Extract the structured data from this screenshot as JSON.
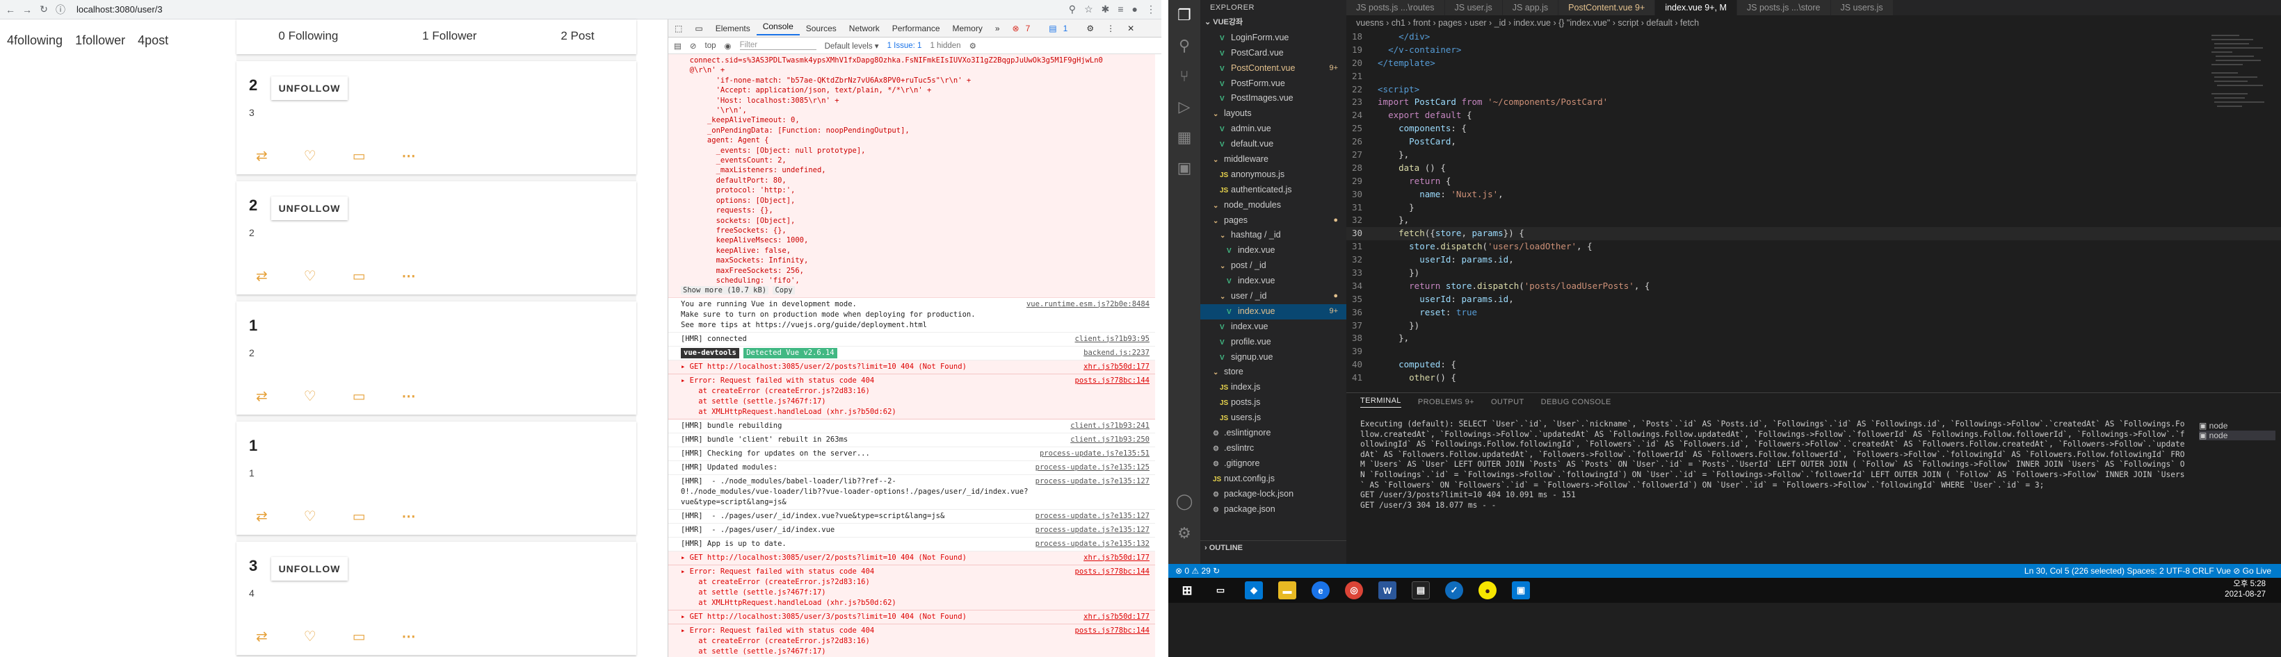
{
  "browser": {
    "url": "localhost:3080/user/3",
    "stats": [
      "4following",
      "1follower",
      "4post"
    ],
    "profile_counts": [
      "0 Following",
      "1 Follower",
      "2 Post"
    ],
    "posts": [
      {
        "num": "2",
        "button": "UNFOLLOW",
        "text": "3"
      },
      {
        "num": "2",
        "button": "UNFOLLOW",
        "text": "2"
      },
      {
        "num": "1",
        "button": "",
        "text": "2"
      },
      {
        "num": "1",
        "button": "",
        "text": "1"
      },
      {
        "num": "3",
        "button": "UNFOLLOW",
        "text": "4"
      }
    ]
  },
  "devtools": {
    "tabs": [
      "Elements",
      "Console",
      "Sources",
      "Network",
      "Performance",
      "Memory",
      "»"
    ],
    "issues_count": "7",
    "msg_count": "1",
    "filter_context": "top",
    "filter_placeholder": "Filter",
    "levels": "Default levels ▾",
    "issue_badge": "1 Issue: 1",
    "hidden": "1 hidden",
    "error_box": "  connect.sid=s%3AS3PDLTwasmk4ypsXMhV1fxDapg8Ozhka.FsNIFmkEIsIUVXo3I1gZ2BqgpJuUwOk3g5M1F9gHjwLn0\n  @\\r\\n' +\n        'if-none-match: \"b57ae-QKtdZbrNz7vU6Ax8PV0+ruTuc5s\"\\r\\n' +\n        'Accept: application/json, text/plain, */*\\r\\n' +\n        'Host: localhost:3085\\r\\n' +\n        '\\r\\n',\n      _keepAliveTimeout: 0,\n      _onPendingData: [Function: noopPendingOutput],\n      agent: Agent {\n        _events: [Object: null prototype],\n        _eventsCount: 2,\n        _maxListeners: undefined,\n        defaultPort: 80,\n        protocol: 'http:',\n        options: [Object],\n        requests: {},\n        sockets: [Object],\n        freeSockets: {},\n        keepAliveMsecs: 1000,\n        keepAlive: false,\n        maxSockets: Infinity,\n        maxFreeSockets: 256,\n        scheduling: 'fifo',",
    "show_more": "Show more (10.7 kB)",
    "copy": "Copy",
    "lines": [
      {
        "text": "You are running Vue in development mode.\nMake sure to turn on production mode when deploying for production.\nSee more tips at https://vuejs.org/guide/deployment.html",
        "src": "vue.runtime.esm.js?2b0e:8484",
        "err": false
      },
      {
        "text": "[HMR] connected",
        "src": "client.js?1b93:95",
        "err": false
      },
      {
        "text": "vue-devtools  Detected Vue v2.6.14",
        "src": "backend.js:2237",
        "err": false,
        "badge": true
      },
      {
        "text": "▸ GET http://localhost:3085/user/2/posts?limit=10 404 (Not Found)",
        "src": "xhr.js?b50d:177",
        "err": true
      },
      {
        "text": "▸ Error: Request failed with status code 404\n    at createError (createError.js?2d83:16)\n    at settle (settle.js?467f:17)\n    at XMLHttpRequest.handleLoad (xhr.js?b50d:62)",
        "src": "posts.js?78bc:144",
        "err": true
      },
      {
        "text": "[HMR] bundle rebuilding",
        "src": "client.js?1b93:241",
        "err": false
      },
      {
        "text": "[HMR] bundle 'client' rebuilt in 263ms",
        "src": "client.js?1b93:250",
        "err": false
      },
      {
        "text": "[HMR] Checking for updates on the server...",
        "src": "process-update.js?e135:51",
        "err": false
      },
      {
        "text": "[HMR] Updated modules:",
        "src": "process-update.js?e135:125",
        "err": false
      },
      {
        "text": "[HMR]  - ./node_modules/babel-loader/lib??ref--2-\n0!./node_modules/vue-loader/lib??vue-loader-options!./pages/user/_id/index.vue?\nvue&type=script&lang=js&",
        "src": "process-update.js?e135:127",
        "err": false
      },
      {
        "text": "[HMR]  - ./pages/user/_id/index.vue?vue&type=script&lang=js&",
        "src": "process-update.js?e135:127",
        "err": false
      },
      {
        "text": "[HMR]  - ./pages/user/_id/index.vue",
        "src": "process-update.js?e135:127",
        "err": false
      },
      {
        "text": "[HMR] App is up to date.",
        "src": "process-update.js?e135:132",
        "err": false
      },
      {
        "text": "▸ GET http://localhost:3085/user/2/posts?limit=10 404 (Not Found)",
        "src": "xhr.js?b50d:177",
        "err": true
      },
      {
        "text": "▸ Error: Request failed with status code 404\n    at createError (createError.js?2d83:16)\n    at settle (settle.js?467f:17)\n    at XMLHttpRequest.handleLoad (xhr.js?b50d:62)",
        "src": "posts.js?78bc:144",
        "err": true
      },
      {
        "text": "▸ GET http://localhost:3085/user/3/posts?limit=10 404 (Not Found)",
        "src": "xhr.js?b50d:177",
        "err": true
      },
      {
        "text": "▸ Error: Request failed with status code 404\n    at createError (createError.js?2d83:16)\n    at settle (settle.js?467f:17)\n    at XMLHttpRequest.handleLoad (xhr.js?b50d:62)",
        "src": "posts.js?78bc:144",
        "err": true
      }
    ]
  },
  "vscode": {
    "explorer_title": "EXPLORER",
    "workspace": "VUE강좌",
    "outline": "OUTLINE",
    "tree": [
      {
        "n": "LoginForm.vue",
        "t": "vue",
        "d": 2
      },
      {
        "n": "PostCard.vue",
        "t": "vue",
        "d": 2
      },
      {
        "n": "PostContent.vue",
        "t": "vue",
        "d": 2,
        "m": "9+"
      },
      {
        "n": "PostForm.vue",
        "t": "vue",
        "d": 2
      },
      {
        "n": "PostImages.vue",
        "t": "vue",
        "d": 2
      },
      {
        "n": "layouts",
        "t": "fold",
        "d": 1
      },
      {
        "n": "admin.vue",
        "t": "vue",
        "d": 2
      },
      {
        "n": "default.vue",
        "t": "vue",
        "d": 2
      },
      {
        "n": "middleware",
        "t": "fold",
        "d": 1
      },
      {
        "n": "anonymous.js",
        "t": "js",
        "d": 2
      },
      {
        "n": "authenticated.js",
        "t": "js",
        "d": 2
      },
      {
        "n": "node_modules",
        "t": "fold",
        "d": 1
      },
      {
        "n": "pages",
        "t": "fold",
        "d": 1,
        "m": "●"
      },
      {
        "n": "hashtag / _id",
        "t": "fold",
        "d": 2
      },
      {
        "n": "index.vue",
        "t": "vue",
        "d": 3
      },
      {
        "n": "post / _id",
        "t": "fold",
        "d": 2
      },
      {
        "n": "index.vue",
        "t": "vue",
        "d": 3
      },
      {
        "n": "user / _id",
        "t": "fold",
        "d": 2,
        "m": "●"
      },
      {
        "n": "index.vue",
        "t": "vue",
        "d": 3,
        "m": "9+",
        "sel": true
      },
      {
        "n": "index.vue",
        "t": "vue",
        "d": 2
      },
      {
        "n": "profile.vue",
        "t": "vue",
        "d": 2
      },
      {
        "n": "signup.vue",
        "t": "vue",
        "d": 2
      },
      {
        "n": "store",
        "t": "fold",
        "d": 1
      },
      {
        "n": "index.js",
        "t": "js",
        "d": 2
      },
      {
        "n": "posts.js",
        "t": "js",
        "d": 2
      },
      {
        "n": "users.js",
        "t": "js",
        "d": 2
      },
      {
        "n": ".eslintignore",
        "t": "gear",
        "d": 1
      },
      {
        "n": ".eslintrc",
        "t": "gear",
        "d": 1
      },
      {
        "n": ".gitignore",
        "t": "gear",
        "d": 1
      },
      {
        "n": "nuxt.config.js",
        "t": "js",
        "d": 1
      },
      {
        "n": "package-lock.json",
        "t": "gear",
        "d": 1
      },
      {
        "n": "package.json",
        "t": "gear",
        "d": 1
      }
    ],
    "tabs": [
      {
        "label": "JS posts.js ...\\routes",
        "act": false
      },
      {
        "label": "JS user.js",
        "act": false
      },
      {
        "label": "JS app.js",
        "act": false
      },
      {
        "label": "PostContent.vue 9+",
        "act": false,
        "mod": true
      },
      {
        "label": "index.vue 9+, M",
        "act": true
      },
      {
        "label": "JS posts.js ...\\store",
        "act": false
      },
      {
        "label": "JS users.js",
        "act": false
      }
    ],
    "breadcrumb": "vuesns › ch1 › front › pages › user › _id › index.vue › {} \"index.vue\" › script › default › fetch",
    "code": [
      {
        "n": "18",
        "h": "    <span class=\"t\">&lt;/div&gt;</span>"
      },
      {
        "n": "19",
        "h": "  <span class=\"t\">&lt;/v-container&gt;</span>"
      },
      {
        "n": "20",
        "h": "<span class=\"t\">&lt;/template&gt;</span>"
      },
      {
        "n": "21",
        "h": ""
      },
      {
        "n": "22",
        "h": "<span class=\"t\">&lt;script&gt;</span>"
      },
      {
        "n": "23",
        "h": "<span class=\"k\">import</span> <span class=\"p\">PostCard</span> <span class=\"k\">from</span> <span class=\"s\">'~/components/PostCard'</span>"
      },
      {
        "n": "24",
        "h": "  <span class=\"k\">export default</span> {"
      },
      {
        "n": "25",
        "h": "    <span class=\"p\">components</span>: {"
      },
      {
        "n": "26",
        "h": "      <span class=\"p\">PostCard</span>,"
      },
      {
        "n": "27",
        "h": "    },"
      },
      {
        "n": "28",
        "h": "    <span class=\"f\">data</span> () {"
      },
      {
        "n": "29",
        "h": "      <span class=\"k\">return</span> {"
      },
      {
        "n": "30",
        "h": "        <span class=\"p\">name</span>: <span class=\"s\">'Nuxt.js'</span>,"
      },
      {
        "n": "31",
        "h": "      }"
      },
      {
        "n": "32",
        "h": "    },"
      },
      {
        "n": "30",
        "h": "    <span class=\"f\">fetch</span>({<span class=\"p\">store</span>, <span class=\"p\">params</span>}) {",
        "cur": true
      },
      {
        "n": "31",
        "h": "      <span class=\"p\">store</span>.<span class=\"f\">dispatch</span>(<span class=\"s\">'users/loadOther'</span>, {"
      },
      {
        "n": "32",
        "h": "        <span class=\"p\">userId</span>: <span class=\"p\">params</span>.<span class=\"p\">id</span>,"
      },
      {
        "n": "33",
        "h": "      })"
      },
      {
        "n": "34",
        "h": "      <span class=\"k\">return</span> <span class=\"p\">store</span>.<span class=\"f\">dispatch</span>(<span class=\"s\">'posts/loadUserPosts'</span>, {"
      },
      {
        "n": "35",
        "h": "        <span class=\"p\">userId</span>: <span class=\"p\">params</span>.<span class=\"p\">id</span>,"
      },
      {
        "n": "36",
        "h": "        <span class=\"p\">reset</span>: <span class=\"t\">true</span>"
      },
      {
        "n": "37",
        "h": "      })"
      },
      {
        "n": "38",
        "h": "    },"
      },
      {
        "n": "39",
        "h": ""
      },
      {
        "n": "40",
        "h": "    <span class=\"p\">computed</span>: {"
      },
      {
        "n": "41",
        "h": "      <span class=\"f\">other</span>() {"
      }
    ],
    "panel_tabs": [
      "TERMINAL",
      "PROBLEMS 9+",
      "OUTPUT",
      "DEBUG CONSOLE"
    ],
    "terminal": "Executing (default): SELECT `User`.`id`, `User`.`nickname`, `Posts`.`id` AS `Posts.id`, `Followings`.`id` AS `Followings.id`, `Followings->Follow`.`createdAt` AS `Followings.Follow.createdAt`, `Followings->Follow`.`updatedAt` AS `Followings.Follow.updatedAt`, `Followings->Follow`.`followerId` AS `Followings.Follow.followerId`, `Followings->Follow`.`followingId` AS `Followings.Follow.followingId`, `Followers`.`id` AS `Followers.id`, `Followers->Follow`.`createdAt` AS `Followers.Follow.createdAt`, `Followers->Follow`.`updatedAt` AS `Followers.Follow.updatedAt`, `Followers->Follow`.`followerId` AS `Followers.Follow.followerId`, `Followers->Follow`.`followingId` AS `Followers.Follow.followingId` FROM `Users` AS `User` LEFT OUTER JOIN `Posts` AS `Posts` ON `User`.`id` = `Posts`.`UserId` LEFT OUTER JOIN ( `Follow` AS `Followings->Follow` INNER JOIN `Users` AS `Followings` ON `Followings`.`id` = `Followings->Follow`.`followingId`) ON `User`.`id` = `Followings->Follow`.`followerId` LEFT OUTER JOIN ( `Follow` AS `Followers->Follow` INNER JOIN `Users` AS `Followers` ON `Followers`.`id` = `Followers->Follow`.`followerId`) ON `User`.`id` = `Followers->Follow`.`followingId` WHERE `User`.`id` = 3;\nGET /user/3/posts?limit=10 404 10.091 ms - 151\nGET /user/3 304 18.077 ms - -",
    "terminals": [
      "node",
      "node"
    ],
    "status_left": "⊗ 0 ⚠ 29  ↻",
    "status_right": "Ln 30, Col 5 (226 selected)   Spaces: 2   UTF-8   CRLF   Vue   ⊘ Go Live",
    "clock_time": "오후 5:28",
    "clock_date": "2021-08-27"
  }
}
